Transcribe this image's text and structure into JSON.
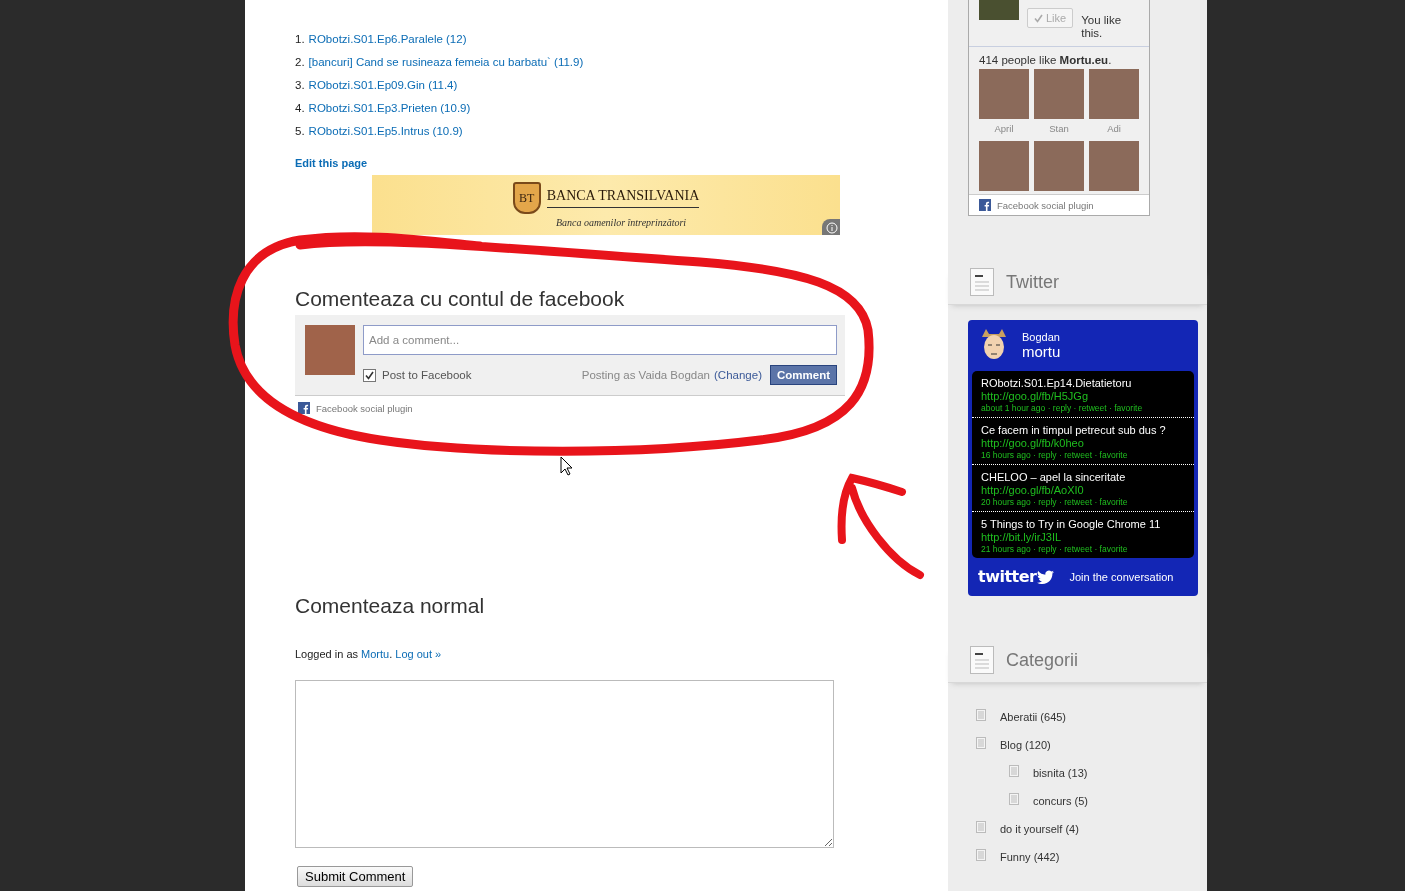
{
  "top_posts": [
    {
      "number": "1.",
      "title": "RObotzi.S01.Ep6.Paralele (12)"
    },
    {
      "number": "2.",
      "title": "[bancuri] Cand se rusineaza femeia cu barbatu` (11.9)"
    },
    {
      "number": "3.",
      "title": "RObotzi.S01.Ep09.Gin (11.4)"
    },
    {
      "number": "4.",
      "title": "RObotzi.S01.Ep3.Prieten (10.9)"
    },
    {
      "number": "5.",
      "title": "RObotzi.S01.Ep5.Intrus (10.9)"
    }
  ],
  "edit_link": "Edit this page",
  "ad_banner": {
    "logo": "BT",
    "brand": "BANCA TRANSILVANIA",
    "tagline": "Banca oamenilor întreprinzători"
  },
  "facebook_comments": {
    "heading": "Comenteaza cu contul de facebook",
    "placeholder": "Add a comment...",
    "post_to_facebook": {
      "label": "Post to Facebook",
      "checked": true
    },
    "posting_as": "Posting as Vaida Bogdan",
    "change_link": "(Change)",
    "button": "Comment",
    "plugin_label": "Facebook social plugin"
  },
  "normal_comments": {
    "heading": "Comenteaza normal",
    "logged_in_prefix": "Logged in as",
    "user_link": "Mortu",
    "separator": ".",
    "logout_link": "Log out »",
    "submit": "Submit Comment"
  },
  "sidebar": {
    "like_box": {
      "like_button": {
        "label": "Like",
        "disabled": true
      },
      "you_like": "You like this.",
      "count_text": "414 people like **Mortu.eu**.",
      "fans": [
        {
          "kind": "named",
          "name": "April"
        },
        {
          "kind": "named",
          "name": "Stan"
        },
        {
          "kind": "named",
          "name": "Adi"
        },
        {
          "kind": "unnamed"
        },
        {
          "kind": "unnamed"
        },
        {
          "kind": "unnamed"
        }
      ],
      "plugin_label": "Facebook social plugin"
    },
    "twitter": {
      "heading": "Twitter",
      "profile": {
        "first_name": "Bogdan",
        "username": "mortu"
      },
      "tweets": [
        {
          "text": "RObotzi.S01.Ep14.Dietatietoru",
          "link": "http://goo.gl/fb/H5JGg",
          "meta": "about 1 hour ago · reply · retweet · favorite"
        },
        {
          "text": "Ce facem in timpul petrecut sub dus ?",
          "link": "http://goo.gl/fb/k0heo",
          "meta": "16 hours ago · reply · retweet · favorite"
        },
        {
          "text": "CHELOO – apel la sinceritate",
          "link": "http://goo.gl/fb/AoXI0",
          "meta": "20 hours ago · reply · retweet · favorite"
        },
        {
          "text": "5 Things to Try in Google Chrome 11",
          "link": "http://bit.ly/irJ3IL",
          "meta": "21 hours ago · reply · retweet · favorite"
        }
      ],
      "logo": "twitter",
      "join_link": "Join the conversation"
    },
    "categories": {
      "heading": "Categorii",
      "items": [
        {
          "label": "Aberatii (645)"
        },
        {
          "label": "Blog (120)",
          "children": [
            {
              "label": "bisnita (13)"
            },
            {
              "label": "concurs (5)"
            }
          ]
        },
        {
          "label": "do it yourself (4)"
        },
        {
          "label": "Funny (442)"
        }
      ]
    }
  }
}
